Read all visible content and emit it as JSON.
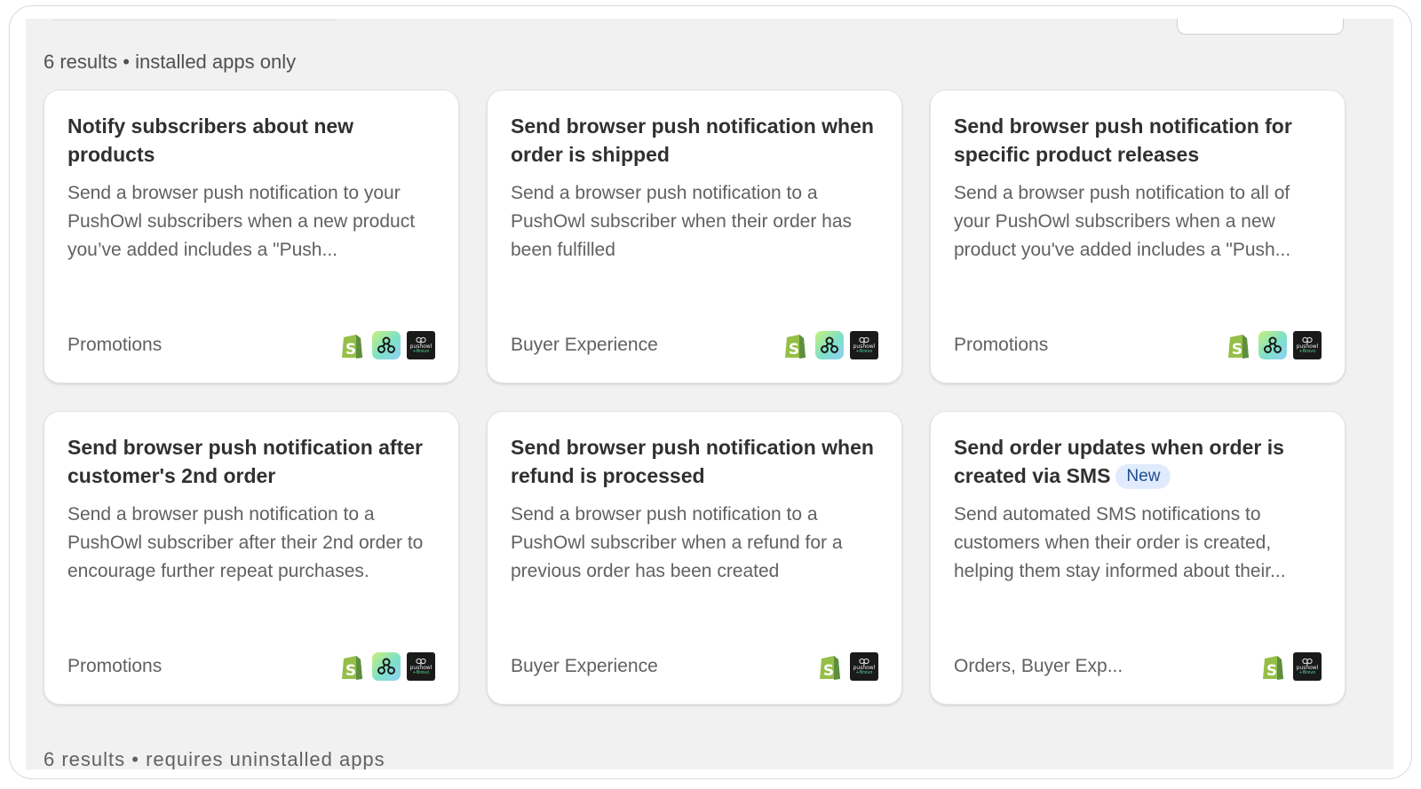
{
  "results": {
    "installed_label": "6 results • installed apps only",
    "uninstalled_label": "6 results • requires uninstalled apps"
  },
  "cards": [
    {
      "title": "Notify subscribers about new products",
      "description": "Send a browser push notification to your PushOwl subscribers when a new product you’ve added includes a \"Push...",
      "category": "Promotions",
      "badge": "",
      "apps": [
        "shopify-icon",
        "flow-icon",
        "pushowl-icon"
      ]
    },
    {
      "title": "Send browser push notification when order is shipped",
      "description": "Send a browser push notification to a PushOwl subscriber when their order has been fulfilled",
      "category": "Buyer Experience",
      "badge": "",
      "apps": [
        "shopify-icon",
        "flow-icon",
        "pushowl-icon"
      ]
    },
    {
      "title": "Send browser push notification for specific product releases",
      "description": "Send a browser push notification to all of your PushOwl subscribers when a new product you've added includes a \"Push...",
      "category": "Promotions",
      "badge": "",
      "apps": [
        "shopify-icon",
        "flow-icon",
        "pushowl-icon"
      ]
    },
    {
      "title": "Send browser push notification after customer's 2nd order",
      "description": "Send a browser push notification to a PushOwl subscriber after their 2nd order to encourage further repeat purchases.",
      "category": "Promotions",
      "badge": "",
      "apps": [
        "shopify-icon",
        "flow-icon",
        "pushowl-icon"
      ]
    },
    {
      "title": "Send browser push notification when refund is processed",
      "description": "Send a browser push notification to a PushOwl subscriber when a refund for a previous order has been created",
      "category": "Buyer Experience",
      "badge": "",
      "apps": [
        "shopify-icon",
        "pushowl-icon"
      ]
    },
    {
      "title": "Send order updates when order is created via SMS",
      "description": "Send automated SMS notifications to customers when their order is created, helping them stay informed about their...",
      "category": "Orders, Buyer Exp...",
      "badge": "New",
      "apps": [
        "shopify-icon",
        "pushowl-icon"
      ]
    }
  ],
  "pushowl_icon": {
    "line1": "pushowl",
    "line2": "+Brevo"
  },
  "colors": {
    "panel_bg": "#f1f1f1",
    "card_bg": "#ffffff",
    "shopify_green": "#95bf47",
    "badge_bg": "#e0ecfd",
    "badge_text": "#1d4b8f"
  }
}
